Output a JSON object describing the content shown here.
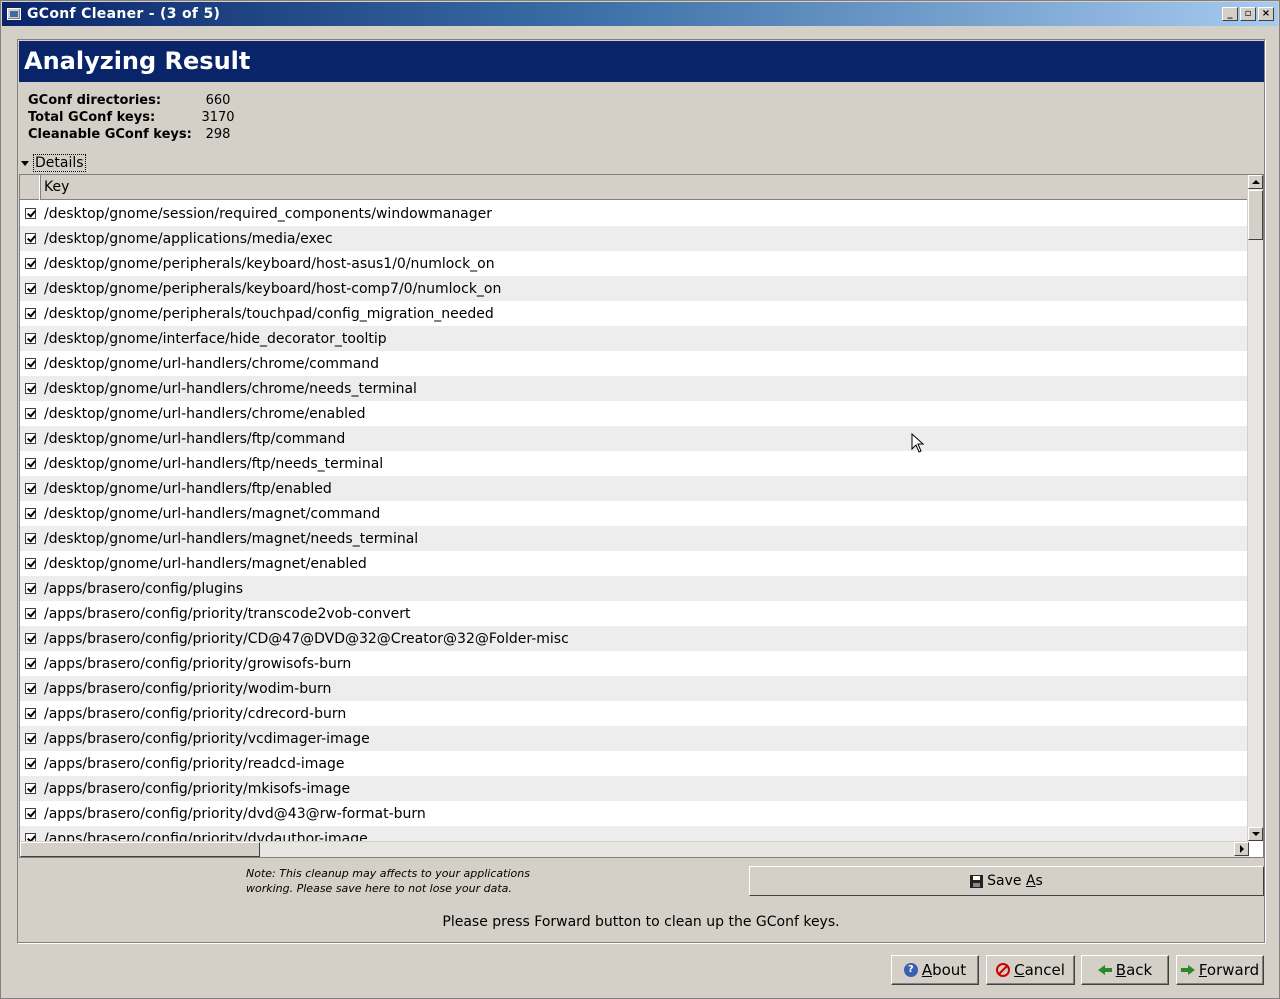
{
  "window": {
    "title": "GConf Cleaner - (3 of 5)"
  },
  "header": {
    "title": "Analyzing Result"
  },
  "stats": [
    {
      "label": "GConf directories:",
      "value": "660"
    },
    {
      "label": "Total GConf keys:",
      "value": "3170"
    },
    {
      "label": "Cleanable GConf keys:",
      "value": "298"
    }
  ],
  "details": {
    "label": "Details"
  },
  "list": {
    "column_key": "Key",
    "rows": [
      "/desktop/gnome/session/required_components/windowmanager",
      "/desktop/gnome/applications/media/exec",
      "/desktop/gnome/peripherals/keyboard/host-asus1/0/numlock_on",
      "/desktop/gnome/peripherals/keyboard/host-comp7/0/numlock_on",
      "/desktop/gnome/peripherals/touchpad/config_migration_needed",
      "/desktop/gnome/interface/hide_decorator_tooltip",
      "/desktop/gnome/url-handlers/chrome/command",
      "/desktop/gnome/url-handlers/chrome/needs_terminal",
      "/desktop/gnome/url-handlers/chrome/enabled",
      "/desktop/gnome/url-handlers/ftp/command",
      "/desktop/gnome/url-handlers/ftp/needs_terminal",
      "/desktop/gnome/url-handlers/ftp/enabled",
      "/desktop/gnome/url-handlers/magnet/command",
      "/desktop/gnome/url-handlers/magnet/needs_terminal",
      "/desktop/gnome/url-handlers/magnet/enabled",
      "/apps/brasero/config/plugins",
      "/apps/brasero/config/priority/transcode2vob-convert",
      "/apps/brasero/config/priority/CD@47@DVD@32@Creator@32@Folder-misc",
      "/apps/brasero/config/priority/growisofs-burn",
      "/apps/brasero/config/priority/wodim-burn",
      "/apps/brasero/config/priority/cdrecord-burn",
      "/apps/brasero/config/priority/vcdimager-image",
      "/apps/brasero/config/priority/readcd-image",
      "/apps/brasero/config/priority/mkisofs-image",
      "/apps/brasero/config/priority/dvd@43@rw-format-burn",
      "/apps/brasero/config/priority/dvdauthor-image"
    ]
  },
  "note": "Note: This cleanup may affects to your applications working. Please save here to not lose your data.",
  "save_as": {
    "label_pre": "Save ",
    "label_ul": "A",
    "label_post": "s"
  },
  "hint": "Please press Forward button to clean up the GConf keys.",
  "buttons": {
    "about": {
      "ul": "A",
      "rest": "bout"
    },
    "cancel": {
      "ul": "C",
      "rest": "ancel"
    },
    "back": {
      "ul": "B",
      "rest": "ack"
    },
    "forward": {
      "ul": "F",
      "rest": "orward"
    }
  }
}
